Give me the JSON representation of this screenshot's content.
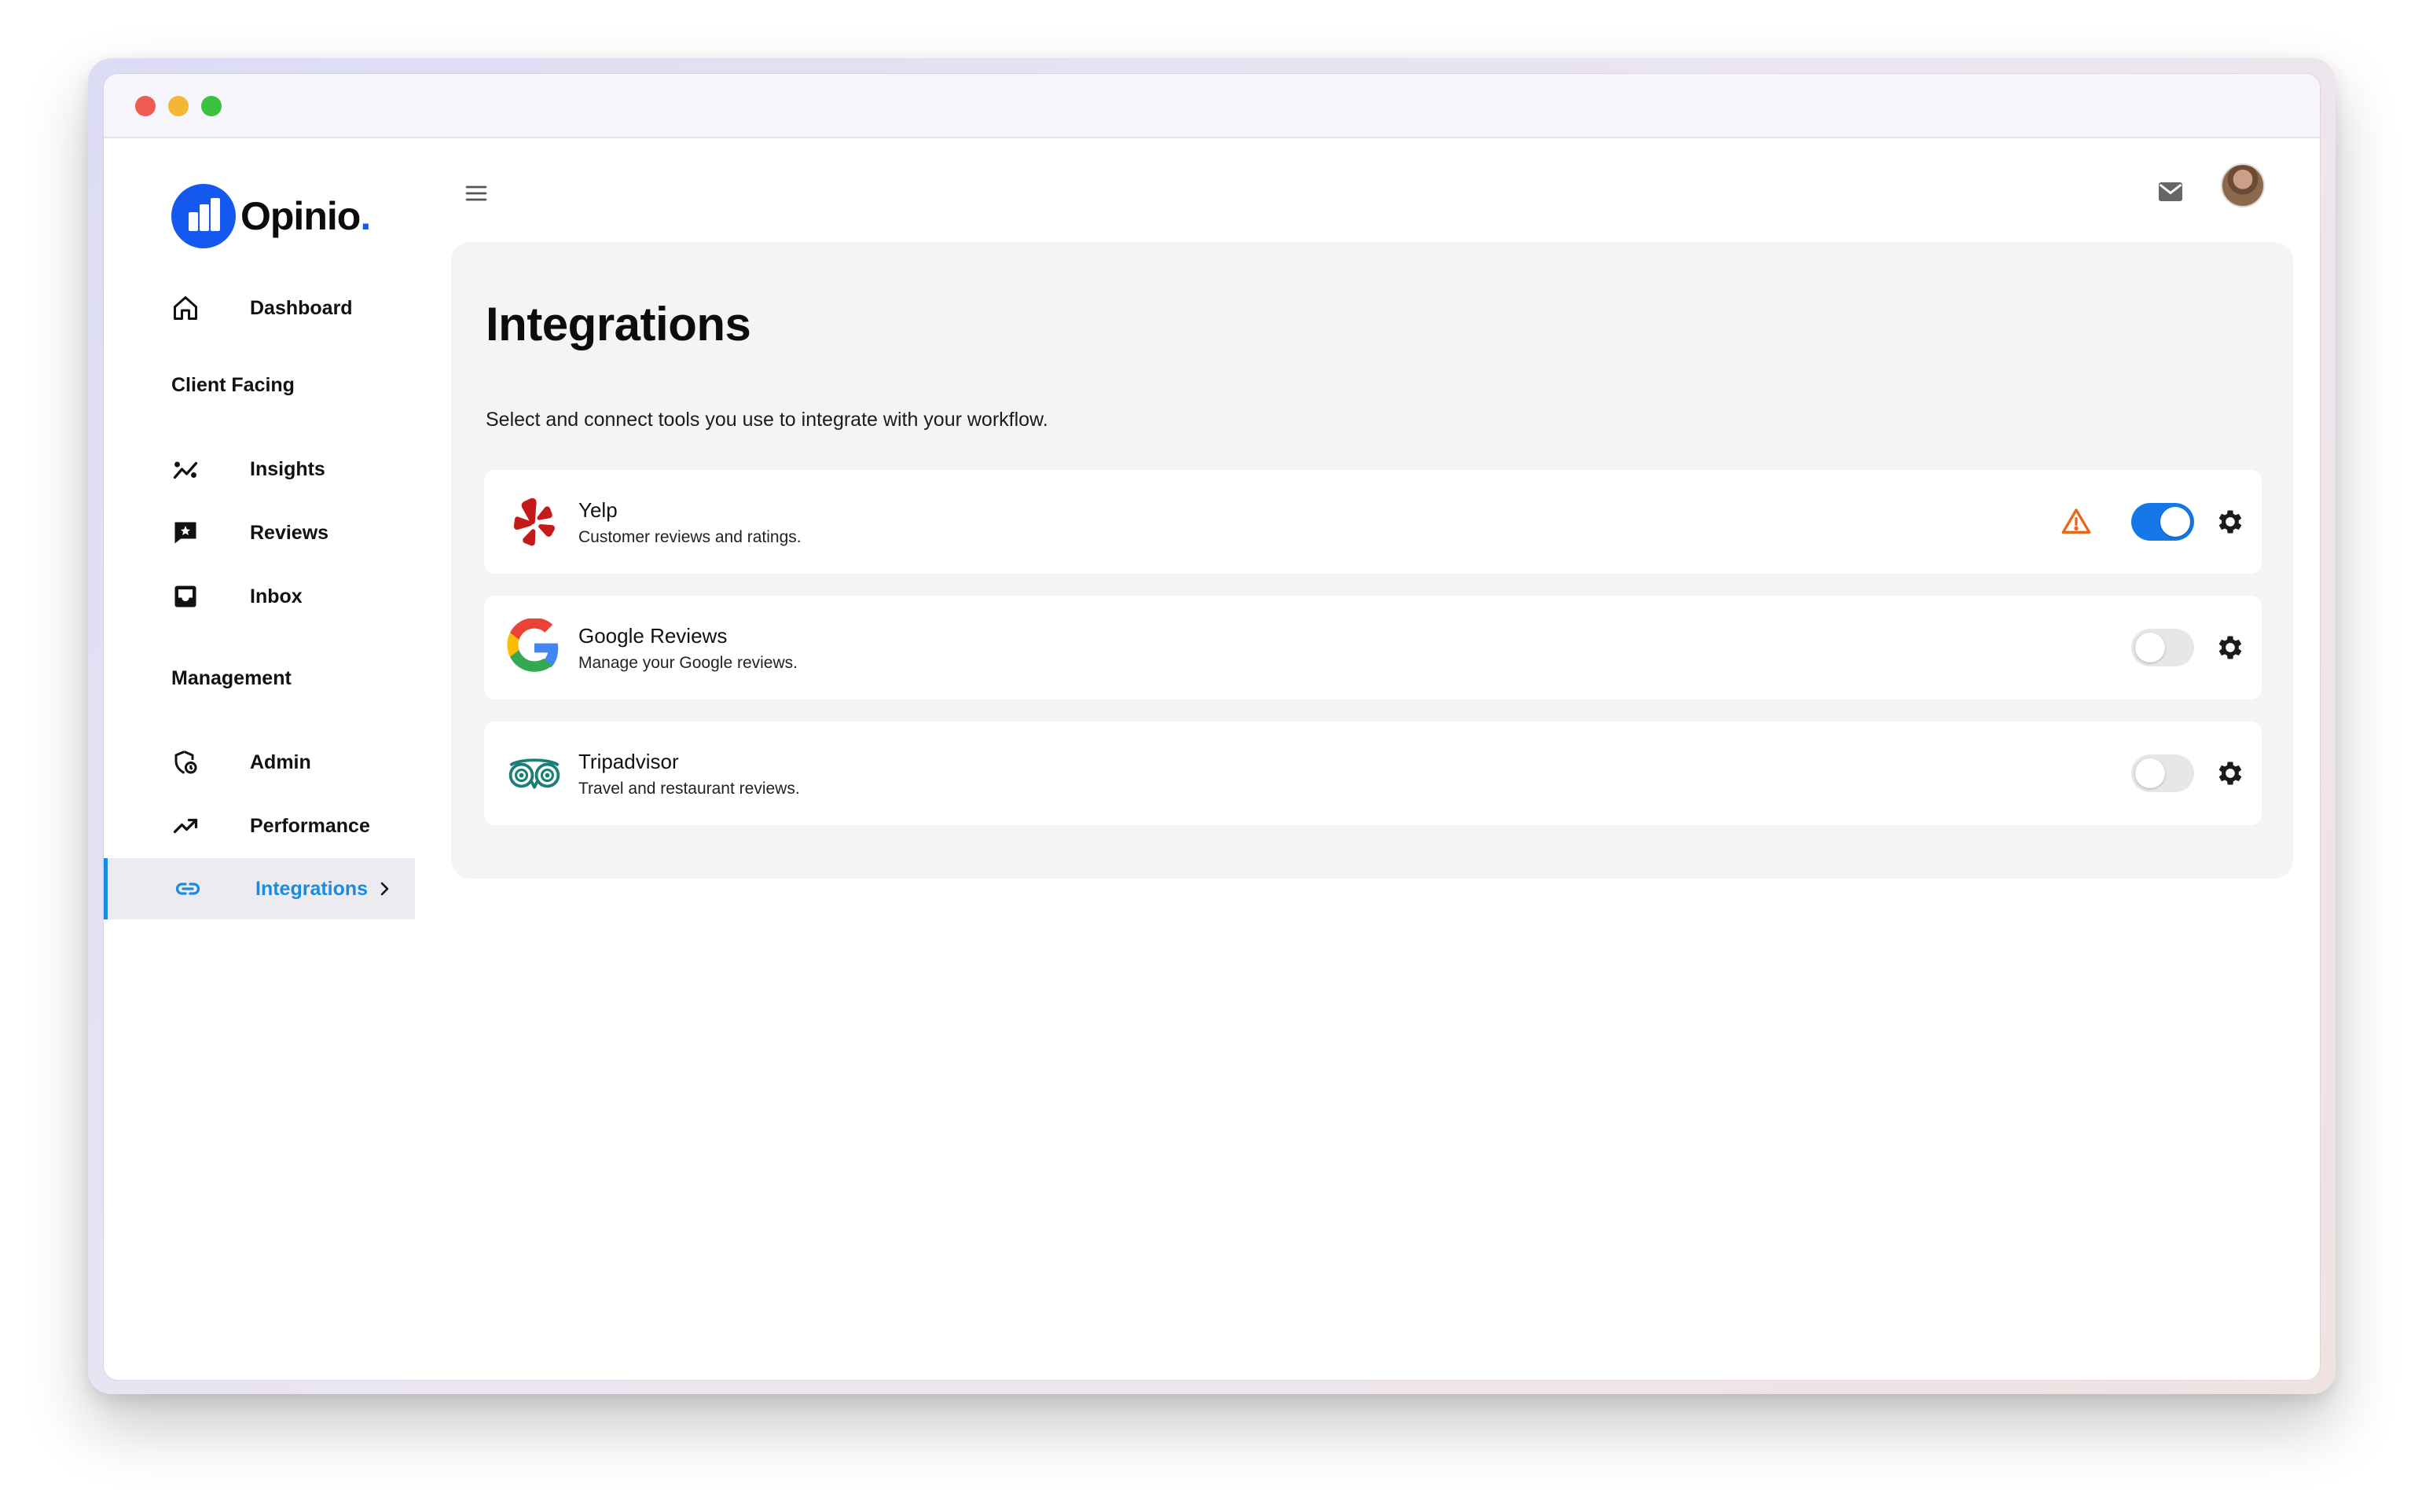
{
  "brand": {
    "name": "Opinio",
    "dot": ".",
    "color": "#1558f0"
  },
  "sidebar": {
    "dashboard": {
      "label": "Dashboard",
      "icon": "home-icon"
    },
    "sections": [
      {
        "title": "Client Facing",
        "items": [
          {
            "label": "Insights",
            "icon": "insights-icon"
          },
          {
            "label": "Reviews",
            "icon": "reviews-icon"
          },
          {
            "label": "Inbox",
            "icon": "inbox-icon"
          }
        ]
      },
      {
        "title": "Management",
        "items": [
          {
            "label": "Admin",
            "icon": "admin-shield-icon"
          },
          {
            "label": "Performance",
            "icon": "trending-up-icon"
          },
          {
            "label": "Integrations",
            "icon": "link-icon",
            "active": true
          }
        ]
      }
    ],
    "active_color": "#1a8be0"
  },
  "header": {
    "menu_icon": "hamburger-menu-icon",
    "mail_icon": "mail-icon",
    "avatar": "user-avatar"
  },
  "main": {
    "title": "Integrations",
    "subtitle": "Select and connect tools you use to integrate with your workflow.",
    "integrations": [
      {
        "name": "Yelp",
        "description": "Customer reviews and ratings.",
        "enabled": true,
        "warning": true,
        "icon": "yelp-logo-icon"
      },
      {
        "name": "Google Reviews",
        "description": "Manage your Google reviews.",
        "enabled": false,
        "warning": false,
        "icon": "google-logo-icon"
      },
      {
        "name": "Tripadvisor",
        "description": "Travel and restaurant reviews.",
        "enabled": false,
        "warning": false,
        "icon": "tripadvisor-logo-icon"
      }
    ]
  }
}
